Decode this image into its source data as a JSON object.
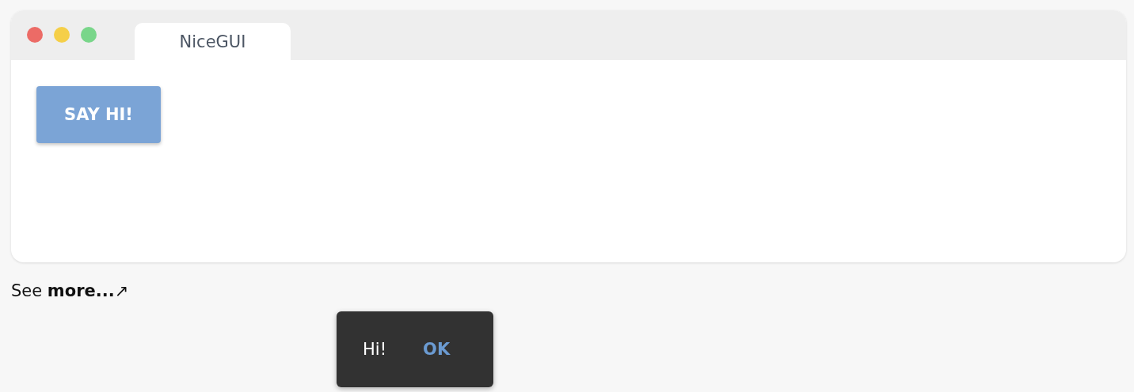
{
  "window": {
    "tab": {
      "label": "NiceGUI",
      "selected": true
    }
  },
  "content": {
    "button": {
      "label": "SAY HI!"
    }
  },
  "see_more": {
    "prefix": "See",
    "link": "more...",
    "arrow": "↗"
  },
  "notification": {
    "message": "Hi!",
    "action": "OK"
  }
}
